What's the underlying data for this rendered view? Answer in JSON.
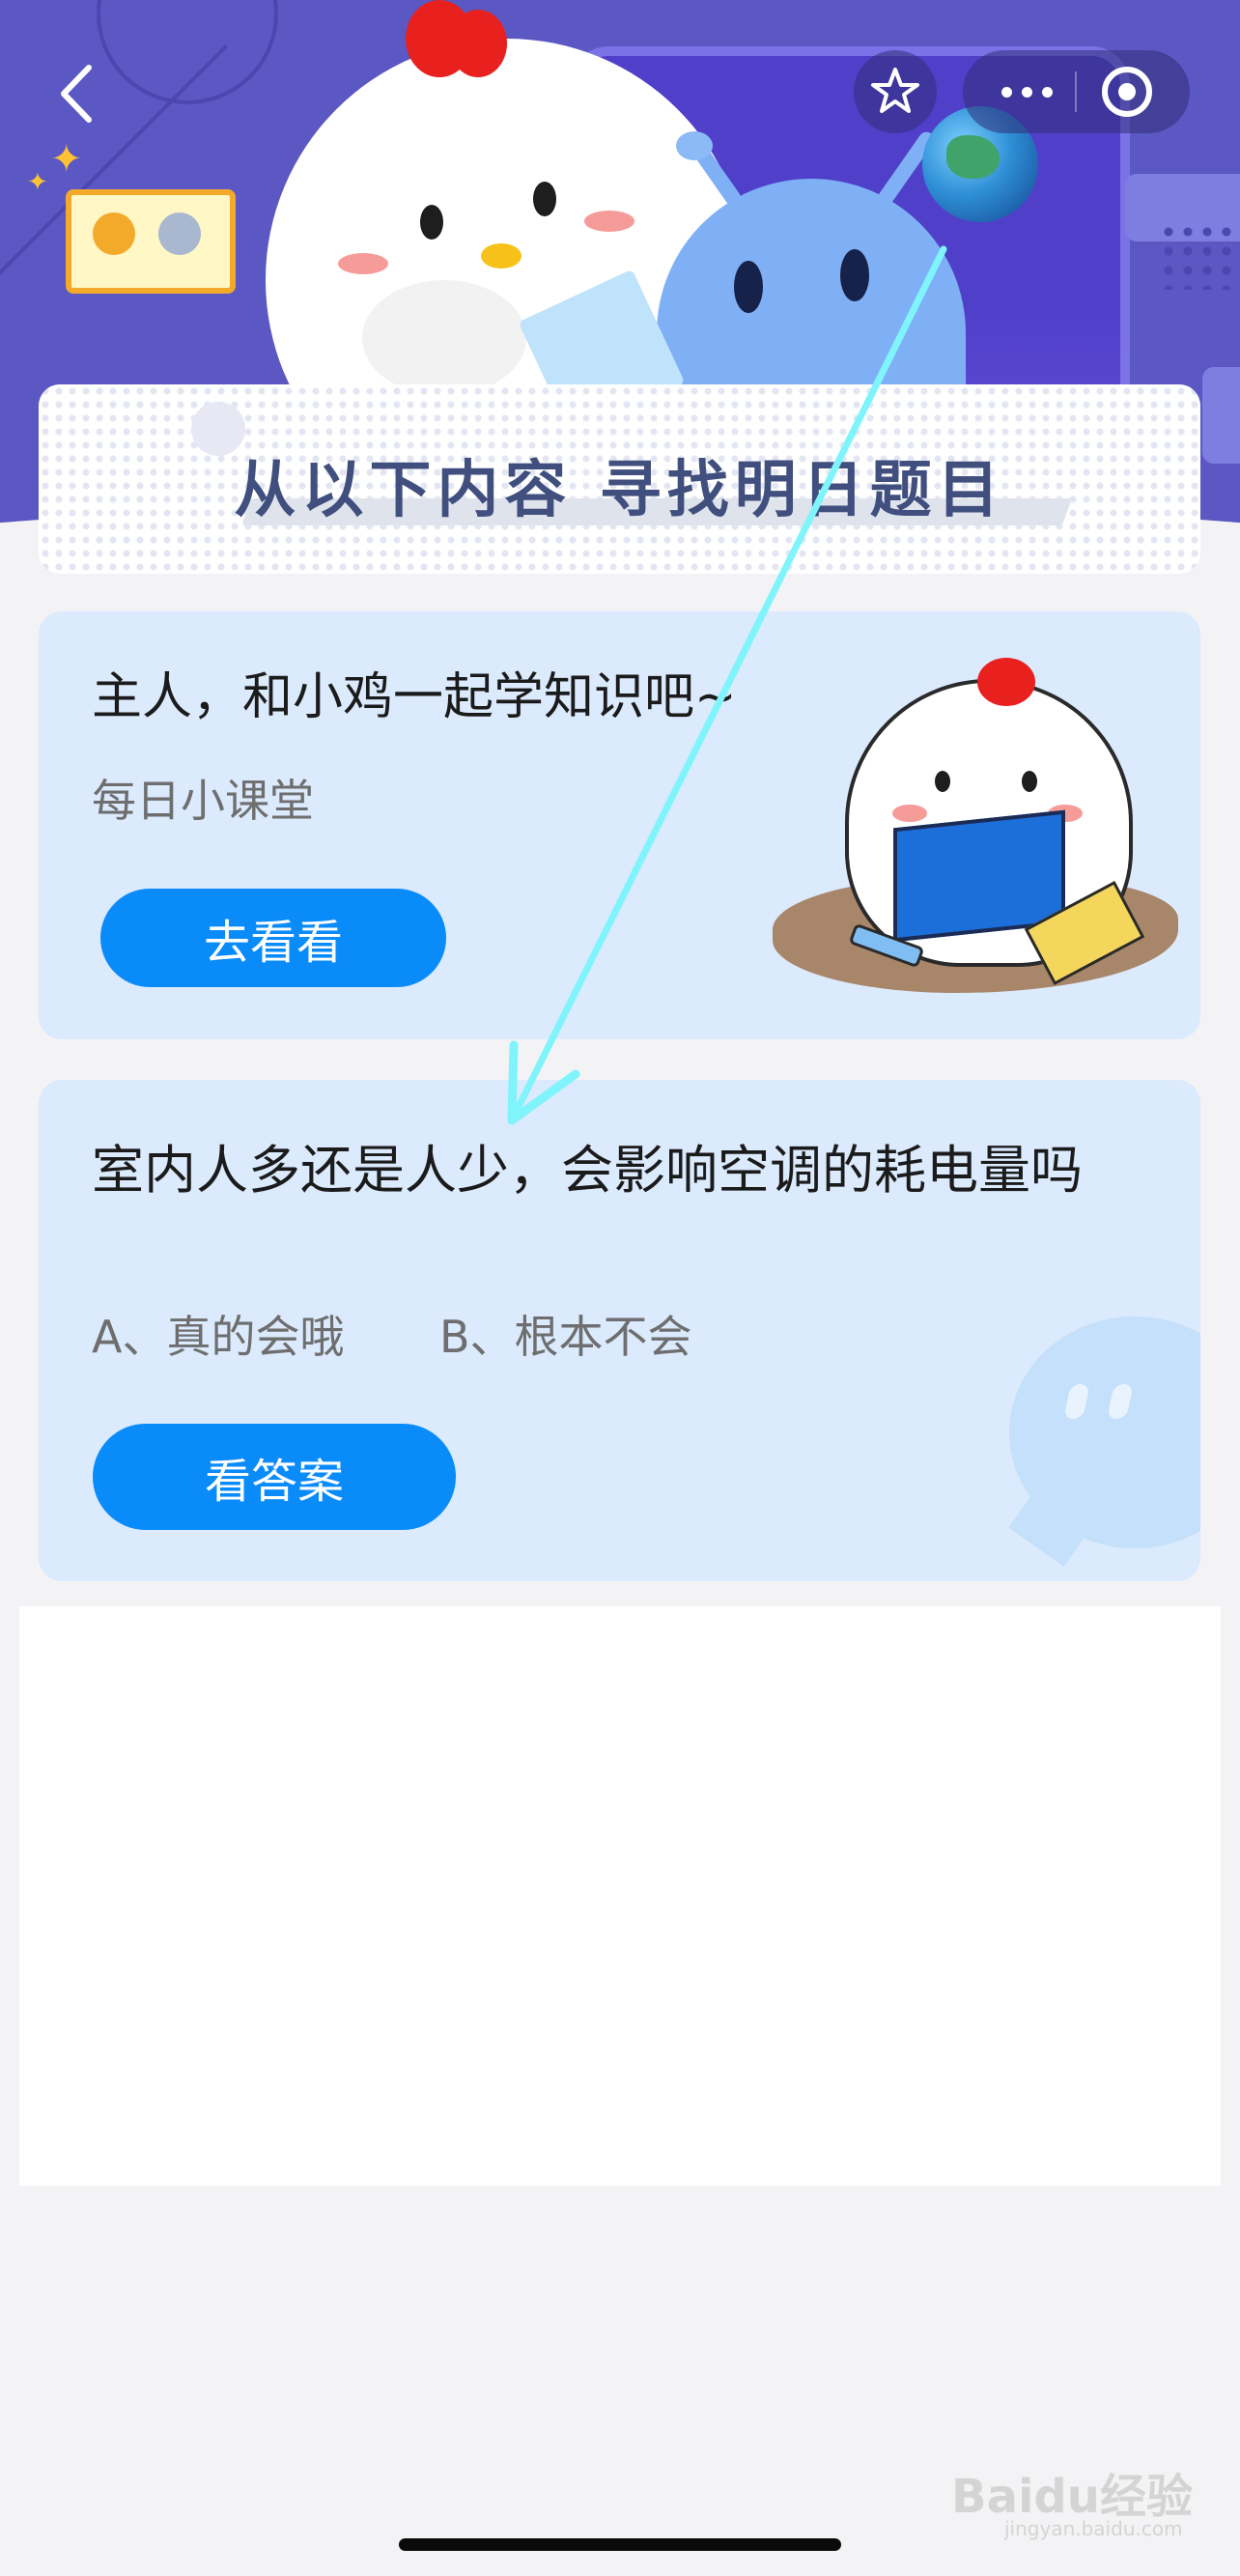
{
  "banner": {
    "title": "从以下内容 寻找明日题目"
  },
  "nav": {
    "back_icon": "chevron-left-icon",
    "favorite_icon": "star-icon",
    "more_icon": "more-dots-icon",
    "close_icon": "target-circle-icon"
  },
  "card_class": {
    "title": "主人，和小鸡一起学知识吧~",
    "subtitle": "每日小课堂",
    "button_label": "去看看"
  },
  "card_question": {
    "question": "室内人多还是人少，会影响空调的耗电量吗",
    "option_a": "A、真的会哦",
    "option_b": "B、根本不会",
    "button_label": "看答案"
  },
  "watermark": {
    "text": "Baidu经验",
    "sub": "jingyan.baidu.com"
  },
  "colors": {
    "header_bg": "#5b58c4",
    "card_bg": "#dbeafd",
    "button_blue": "#0a8bfa",
    "annotation_arrow": "#7ff5fb"
  }
}
